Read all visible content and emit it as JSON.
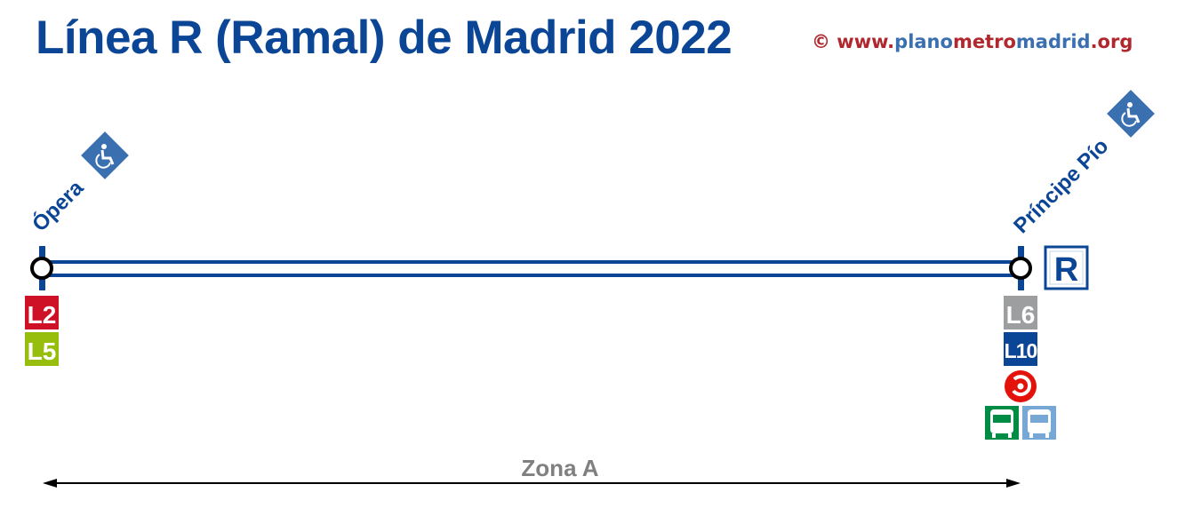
{
  "title": "Línea R (Ramal) de Madrid 2022",
  "copyright": {
    "symbol": "© www.",
    "part1": "plano",
    "part2": "metro",
    "part3": "madrid",
    "part4": ".org"
  },
  "colors": {
    "line": "#0b4596",
    "copyright_red": "#b0282e",
    "copyright_blue": "#3a6fb0",
    "accessible": "#3a6fb0",
    "zone": "#808080"
  },
  "line_badge": "R",
  "stations": [
    {
      "name": "Ópera",
      "accessible": true,
      "connections": [
        {
          "label": "L2",
          "color": "#cf1127"
        },
        {
          "label": "L5",
          "color": "#97be0d"
        }
      ]
    },
    {
      "name": "Príncipe Pío",
      "accessible": true,
      "connections": [
        {
          "label": "L6",
          "color": "#9c9e9f"
        },
        {
          "label": "L10",
          "color": "#0b4596"
        }
      ],
      "extras": [
        "cercanias-icon",
        "interurban-bus-icon",
        "urban-bus-icon"
      ]
    }
  ],
  "zone": "Zona A"
}
